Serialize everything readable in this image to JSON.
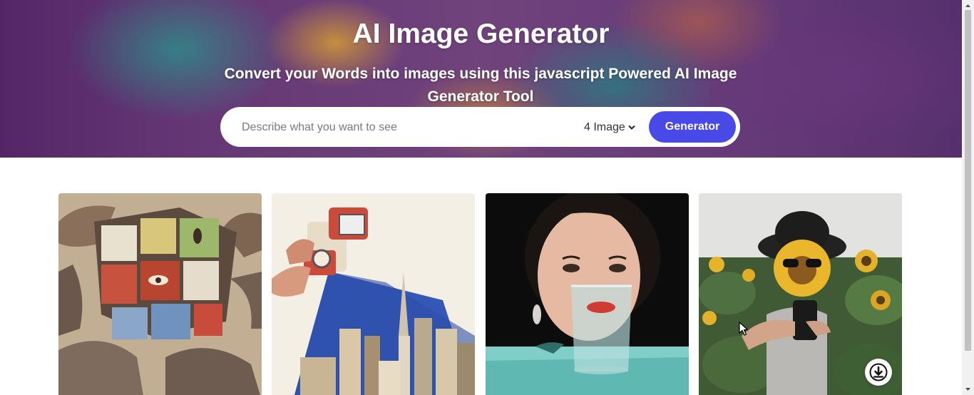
{
  "hero": {
    "title": "AI Image Generator",
    "subtitle": "Convert your Words into images using this javascript Powered AI Image Generator Tool"
  },
  "search": {
    "placeholder": "Describe what you want to see",
    "value": "",
    "image_count": "4 Image",
    "generate_label": "Generator"
  },
  "gallery": {
    "images": [
      {
        "subject": "rubiks-cube-painting"
      },
      {
        "subject": "camera-city-collage"
      },
      {
        "subject": "woman-glass-portrait"
      },
      {
        "subject": "sunflower-head-person",
        "download_icon": "download-icon"
      }
    ]
  },
  "colors": {
    "accent": "#4949e7",
    "hero_purple": "#6d3d7d",
    "page_bg": "#ffffff"
  }
}
